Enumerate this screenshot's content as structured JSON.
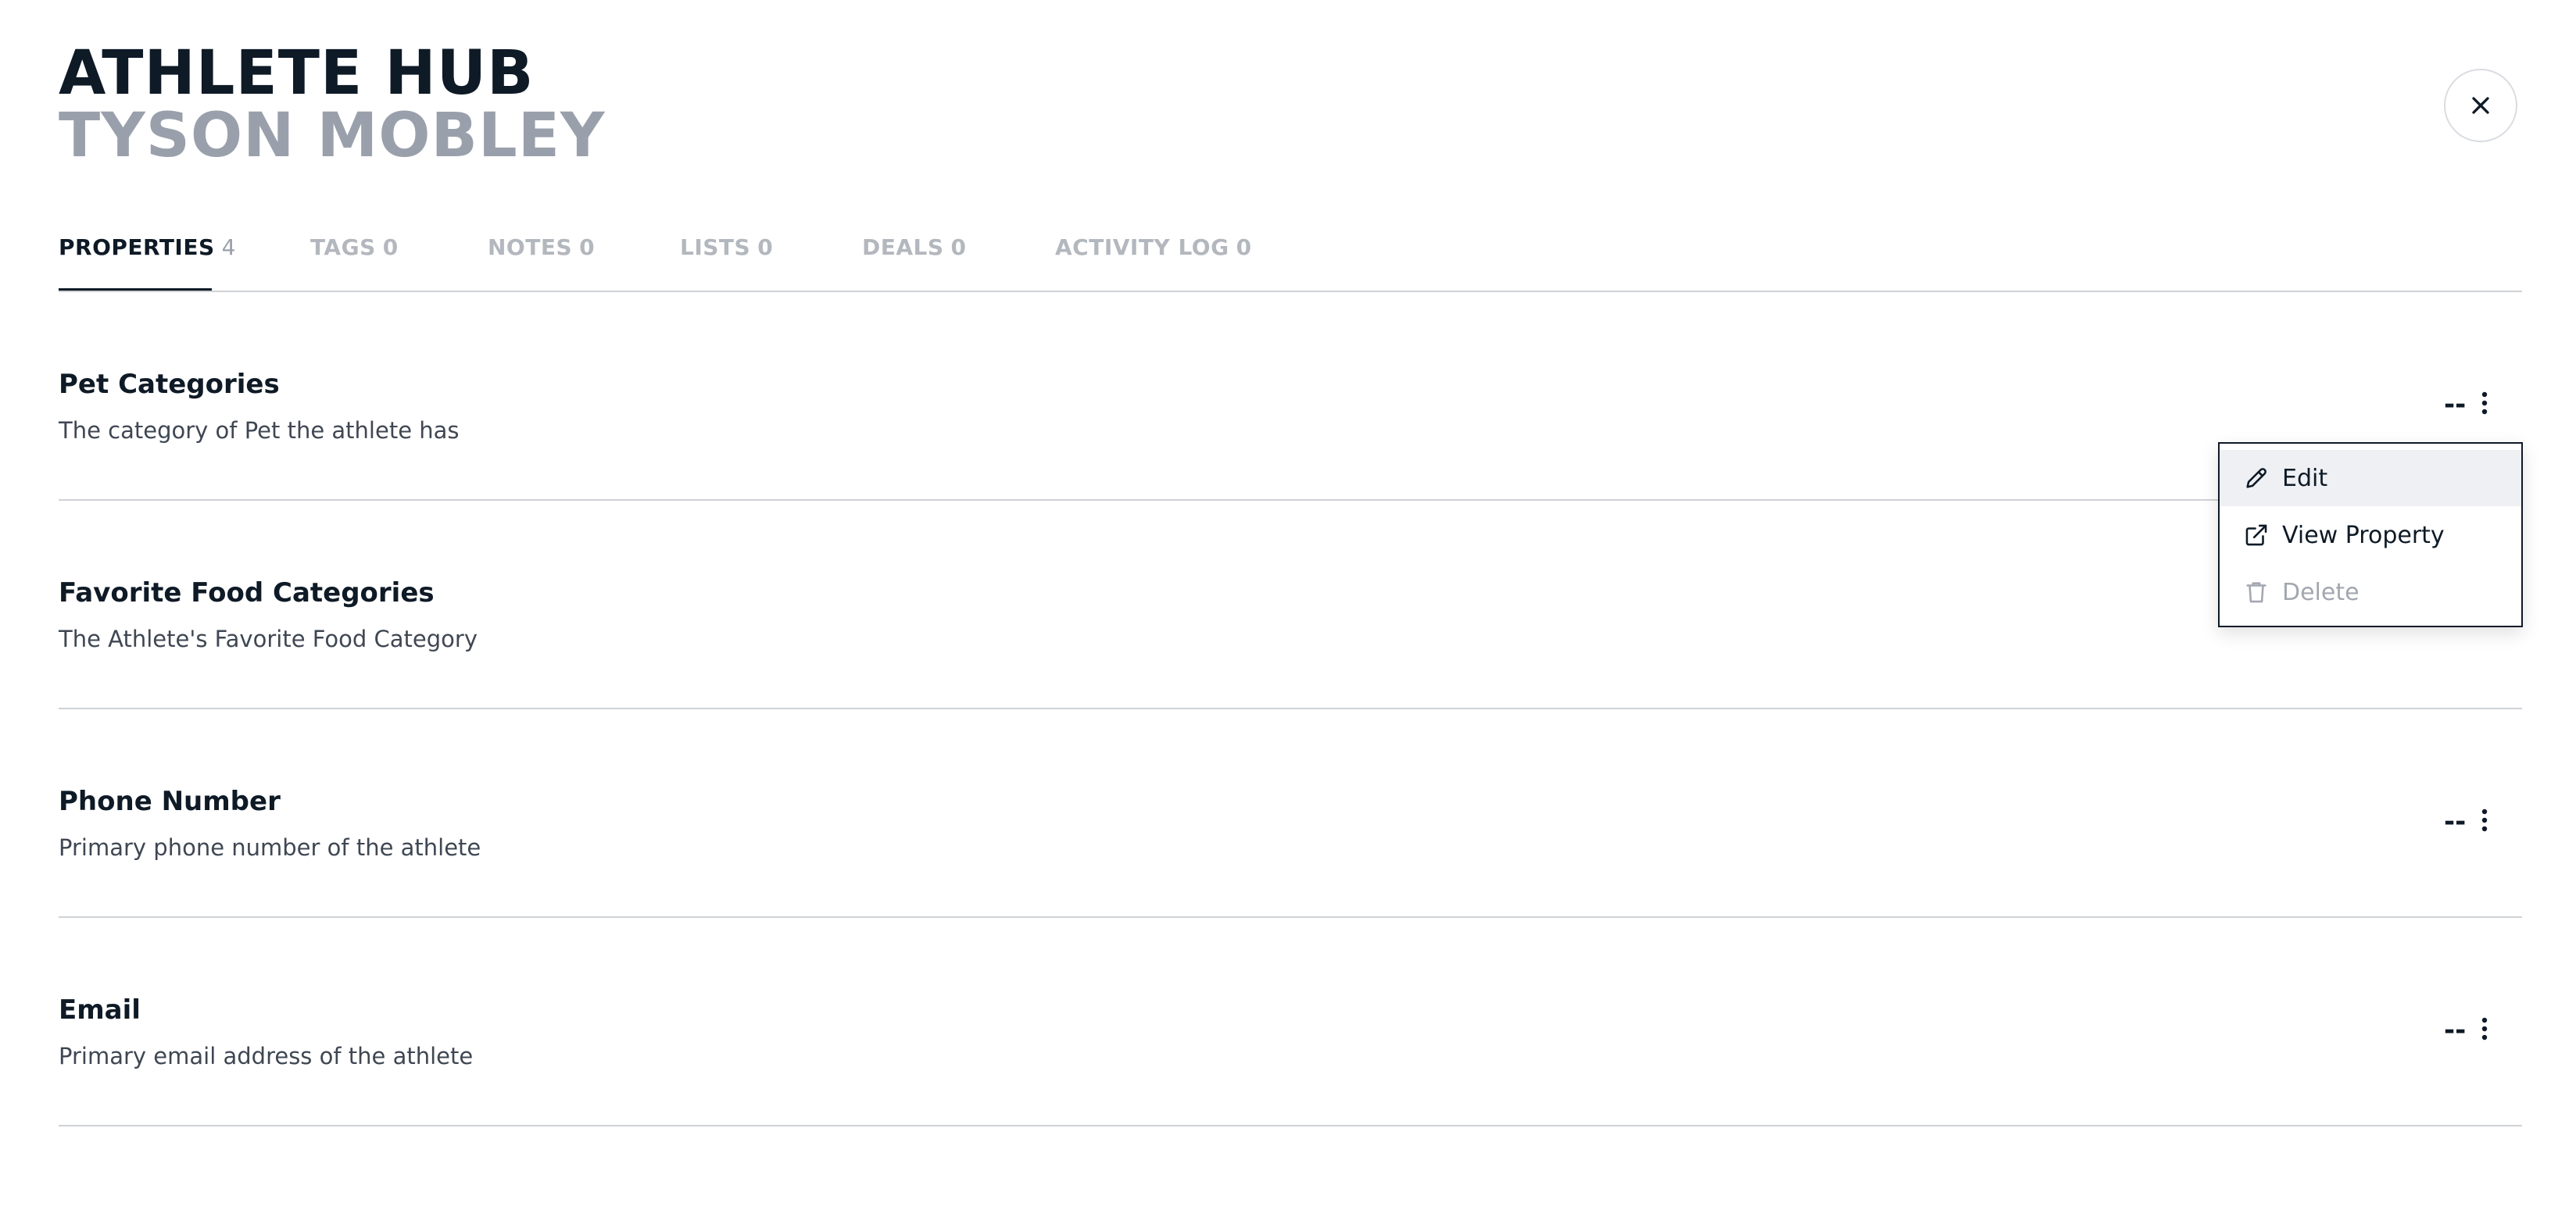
{
  "header": {
    "title": "ATHLETE HUB",
    "athlete_name": "TYSON MOBLEY"
  },
  "close_icon": "close-icon",
  "tabs": [
    {
      "label": "PROPERTIES",
      "count": "4",
      "active": true
    },
    {
      "label": "TAGS",
      "count": "0",
      "active": false
    },
    {
      "label": "NOTES",
      "count": "0",
      "active": false
    },
    {
      "label": "LISTS",
      "count": "0",
      "active": false
    },
    {
      "label": "DEALS",
      "count": "0",
      "active": false
    },
    {
      "label": "ACTIVITY LOG",
      "count": "0",
      "active": false
    }
  ],
  "properties": [
    {
      "title": "Pet Categories",
      "description": "The category of Pet the athlete has",
      "value": "--"
    },
    {
      "title": "Favorite Food Categories",
      "description": "The Athlete's Favorite Food Category",
      "value": "--"
    },
    {
      "title": "Phone Number",
      "description": "Primary phone number of the athlete",
      "value": "--"
    },
    {
      "title": "Email",
      "description": "Primary email address of the athlete",
      "value": "--"
    }
  ],
  "menu": {
    "items": [
      {
        "label": "Edit",
        "icon": "pencil-icon",
        "highlighted": true,
        "disabled": false
      },
      {
        "label": "View Property",
        "icon": "external-link-icon",
        "highlighted": false,
        "disabled": false
      },
      {
        "label": "Delete",
        "icon": "trash-icon",
        "highlighted": false,
        "disabled": true
      }
    ]
  },
  "colors": {
    "primary_text": "#0e1a26",
    "muted_text": "#9aa0ab",
    "inactive_tab": "#b3b7be",
    "divider": "#cfd2d6",
    "menu_highlight": "#eef0f3"
  }
}
